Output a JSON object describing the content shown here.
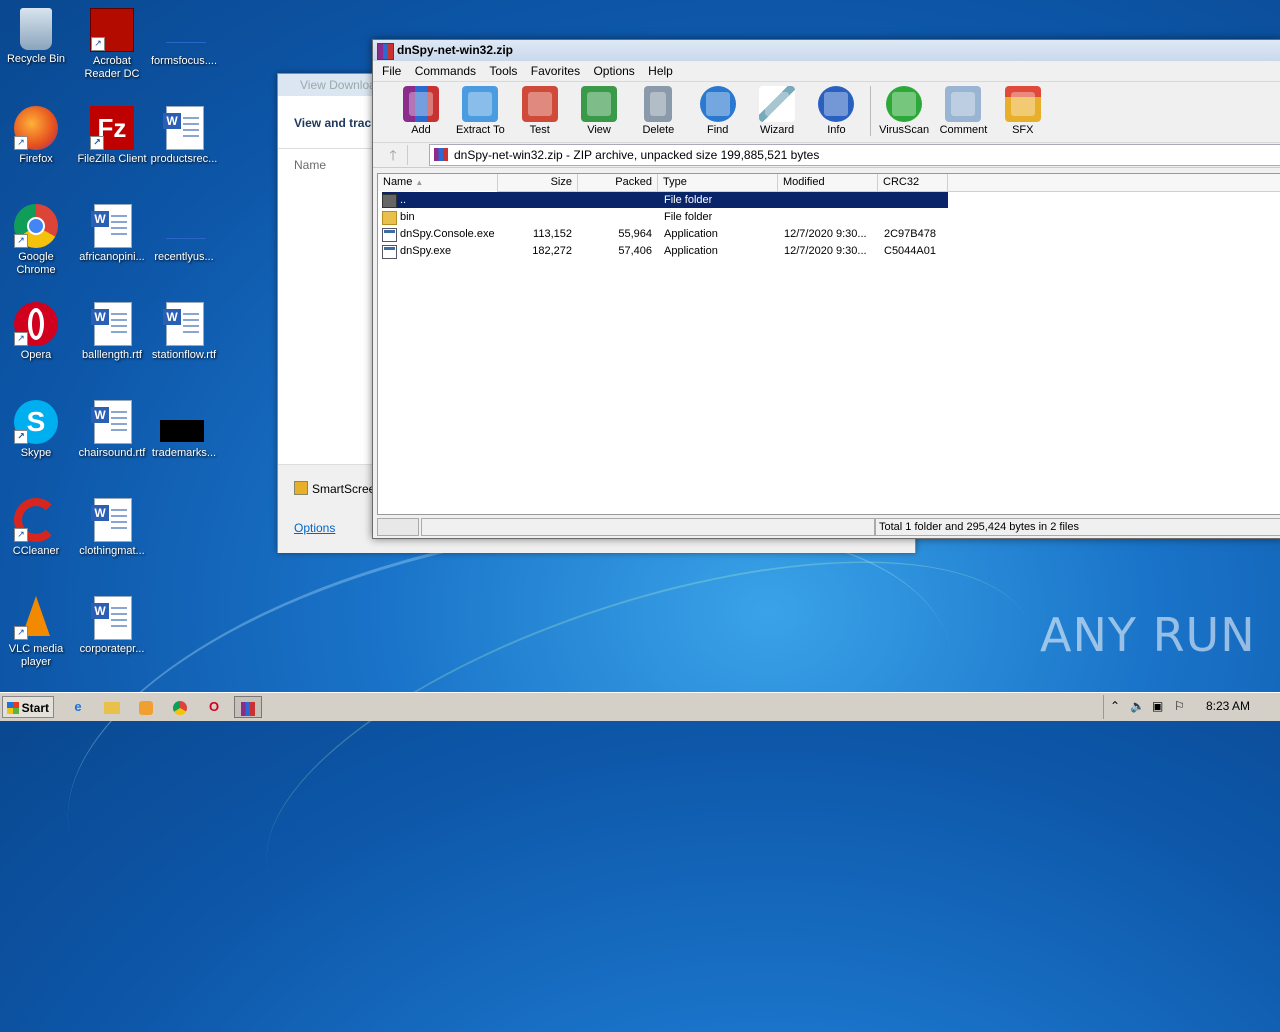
{
  "desktop": {
    "icons": [
      {
        "label": "Recycle Bin"
      },
      {
        "label": "Acrobat Reader DC"
      },
      {
        "label": "formsfocus...."
      },
      {
        "label": "Firefox"
      },
      {
        "label": "FileZilla Client"
      },
      {
        "label": "productsrec..."
      },
      {
        "label": "Google Chrome"
      },
      {
        "label": "africanopini..."
      },
      {
        "label": "recentlyus..."
      },
      {
        "label": "Opera"
      },
      {
        "label": "balllength.rtf"
      },
      {
        "label": "stationflow.rtf"
      },
      {
        "label": "Skype"
      },
      {
        "label": "chairsound.rtf"
      },
      {
        "label": "trademarks..."
      },
      {
        "label": "CCleaner"
      },
      {
        "label": "clothingmat..."
      },
      {
        "label": "VLC media player"
      },
      {
        "label": "corporatepr..."
      }
    ]
  },
  "ie_window": {
    "title": "View Downloa",
    "heading": "View and track",
    "column_name": "Name",
    "smartscreen": "SmartScree",
    "options": "Options"
  },
  "winrar": {
    "title": "dnSpy-net-win32.zip",
    "menu": [
      "File",
      "Commands",
      "Tools",
      "Favorites",
      "Options",
      "Help"
    ],
    "toolbar": [
      "Add",
      "Extract To",
      "Test",
      "View",
      "Delete",
      "Find",
      "Wizard",
      "Info",
      "VirusScan",
      "Comment",
      "SFX"
    ],
    "address": "dnSpy-net-win32.zip - ZIP archive, unpacked size 199,885,521 bytes",
    "columns": {
      "name": "Name",
      "size": "Size",
      "packed": "Packed",
      "type": "Type",
      "modified": "Modified",
      "crc": "CRC32"
    },
    "rows": [
      {
        "name": "..",
        "size": "",
        "packed": "",
        "type": "File folder",
        "modified": "",
        "crc": ""
      },
      {
        "name": "bin",
        "size": "",
        "packed": "",
        "type": "File folder",
        "modified": "",
        "crc": ""
      },
      {
        "name": "dnSpy.Console.exe",
        "size": "113,152",
        "packed": "55,964",
        "type": "Application",
        "modified": "12/7/2020 9:30...",
        "crc": "2C97B478"
      },
      {
        "name": "dnSpy.exe",
        "size": "182,272",
        "packed": "57,406",
        "type": "Application",
        "modified": "12/7/2020 9:30...",
        "crc": "C5044A01"
      }
    ],
    "status": "Total 1 folder and 295,424 bytes in 2 files"
  },
  "taskbar": {
    "start": "Start",
    "clock": "8:23 AM"
  },
  "watermark": "ANY RUN",
  "colors": {
    "selection": "#0a246a",
    "desktop": "#1a74c9"
  }
}
